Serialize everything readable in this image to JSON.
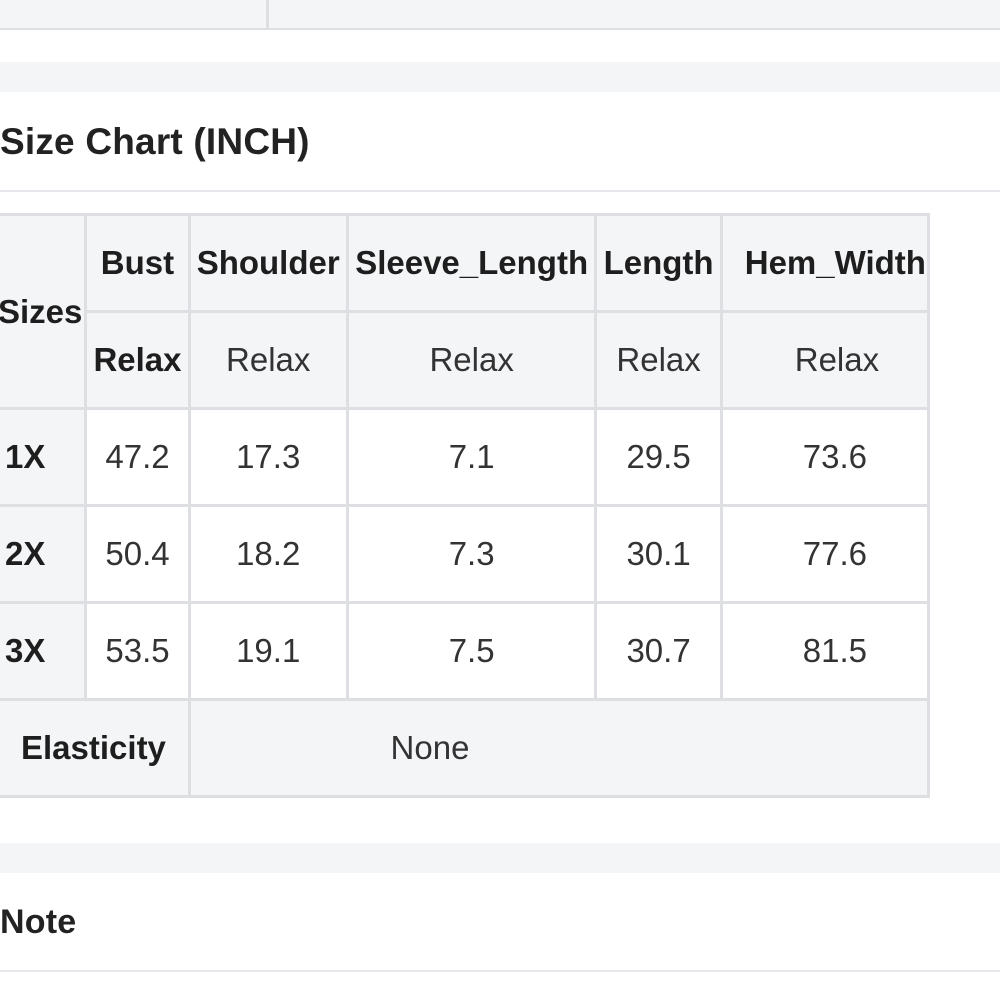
{
  "size_chart": {
    "title": "Size Chart (INCH)",
    "corner_header": "Sizes",
    "columns": [
      {
        "name": "Bust",
        "fit": "Relax"
      },
      {
        "name": "Shoulder",
        "fit": "Relax"
      },
      {
        "name": "Sleeve_Length",
        "fit": "Relax"
      },
      {
        "name": "Length",
        "fit": "Relax"
      },
      {
        "name": "Hem_Width",
        "fit": "Relax"
      }
    ],
    "rows": [
      {
        "size": "1X",
        "values": [
          "47.2",
          "17.3",
          "7.1",
          "29.5",
          "73.6"
        ]
      },
      {
        "size": "2X",
        "values": [
          "50.4",
          "18.2",
          "7.3",
          "30.1",
          "77.6"
        ]
      },
      {
        "size": "3X",
        "values": [
          "53.5",
          "19.1",
          "7.5",
          "30.7",
          "81.5"
        ]
      }
    ],
    "elasticity_label": "Elasticity",
    "elasticity_value": "None"
  },
  "note": {
    "title": "Note"
  }
}
